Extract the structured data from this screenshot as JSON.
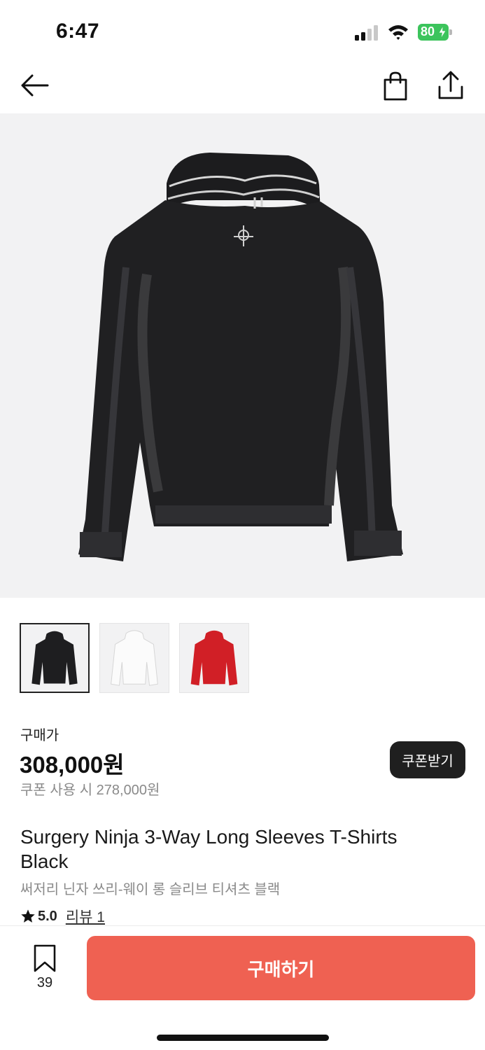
{
  "status_bar": {
    "time": "6:47",
    "battery": "80",
    "icons": [
      "signal-icon",
      "wifi-icon",
      "battery-icon"
    ]
  },
  "nav": {
    "icons": [
      "back-arrow-icon",
      "shopping-bag-icon",
      "share-icon"
    ]
  },
  "product": {
    "thumbnails": [
      {
        "color": "#1e1e20",
        "selected": true
      },
      {
        "color": "#f4f4f4",
        "selected": false
      },
      {
        "color": "#d11f26",
        "selected": false
      }
    ],
    "price_label": "구매가",
    "price": "308,000원",
    "coupon_price_text": "쿠폰 사용 시 278,000원",
    "coupon_button": "쿠폰받기",
    "name_en": "Surgery Ninja 3-Way Long Sleeves T-Shirts Black",
    "name_ko": "써저리 닌자 쓰리-웨이 롱 슬리브 티셔츠 블랙",
    "rating": "5.0",
    "review_link": "리뷰 1"
  },
  "bottom_bar": {
    "bookmark_count": "39",
    "buy_button": "구매하기"
  },
  "colors": {
    "accent": "#ef6152",
    "battery": "#3cc45c",
    "dark_button": "#1f1f1f",
    "muted_text": "#8a8a8a"
  }
}
